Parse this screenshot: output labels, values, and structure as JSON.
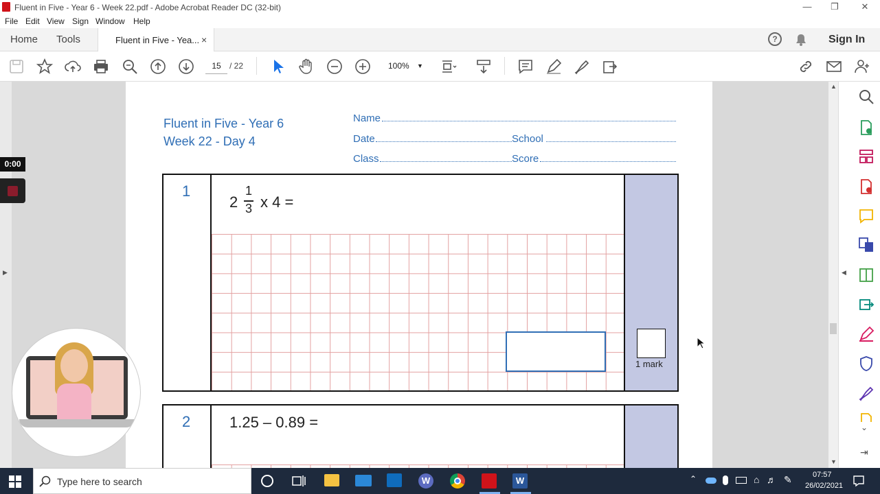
{
  "window": {
    "title": "Fluent in Five - Year 6 - Week 22.pdf - Adobe Acrobat Reader DC (32-bit)"
  },
  "menu": [
    "File",
    "Edit",
    "View",
    "Sign",
    "Window",
    "Help"
  ],
  "tabs": {
    "home": "Home",
    "tools": "Tools",
    "document": "Fluent in Five - Yea...",
    "close": "×"
  },
  "header_right": {
    "sign_in": "Sign In"
  },
  "toolbar": {
    "page_current": "15",
    "page_total": "/ 22",
    "zoom": "100%"
  },
  "recording": {
    "timer": "0:00"
  },
  "document": {
    "title_line1": "Fluent in Five - Year 6",
    "title_line2": "Week 22 - Day 4",
    "fields": {
      "name": "Name",
      "date": "Date",
      "school": "School",
      "class": "Class",
      "score": "Score"
    },
    "questions": [
      {
        "number": "1",
        "whole": "2",
        "numerator": "1",
        "denominator": "3",
        "rest": "x 4 =",
        "mark": "1 mark"
      },
      {
        "number": "2",
        "text": "1.25 – 0.89 ="
      }
    ]
  },
  "taskbar": {
    "search_placeholder": "Type here to search",
    "time": "07:57",
    "date": "26/02/2021"
  },
  "colors": {
    "accent": "#2f6eb5",
    "mark_column": "#c3c8e3",
    "grid_line": "#e3a0a0",
    "pdf_red": "#d0131a",
    "taskbar": "#1e2a3d"
  }
}
